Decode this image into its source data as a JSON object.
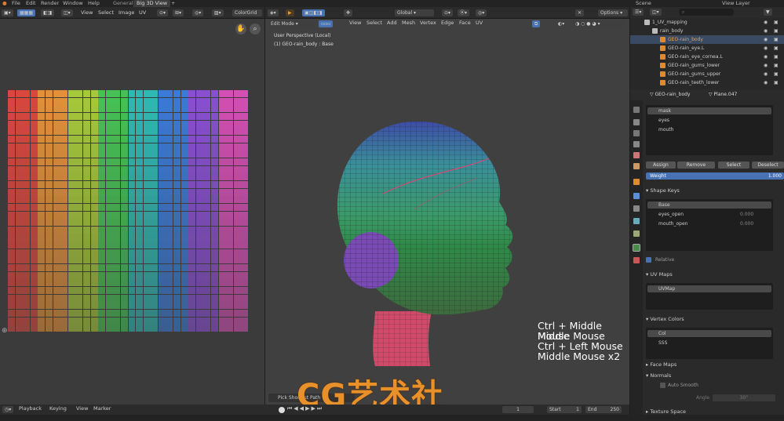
{
  "topbar": {
    "menus": [
      "File",
      "Edit",
      "Render",
      "Window",
      "Help"
    ],
    "workspace_tabs": [
      "General",
      "Big 3D View"
    ],
    "active_tab": "Big 3D View",
    "scene_label": "Scene",
    "view_layer_label": "View Layer"
  },
  "uv_editor": {
    "menus": [
      "View",
      "Select",
      "Image",
      "UV"
    ],
    "image_name": "ColorGrid",
    "grid_colors": [
      "#d9473f",
      "#e2913a",
      "#a5c93a",
      "#46c254",
      "#2fb9b3",
      "#3b7ad6",
      "#8a4fd1",
      "#d34fb3"
    ]
  },
  "viewport": {
    "mode": "Edit Mode",
    "menus": [
      "View",
      "Select",
      "Add",
      "Mesh",
      "Vertex",
      "Edge",
      "Face",
      "UV"
    ],
    "orientation": "Global",
    "options_label": "Options",
    "perspective_label": "User Perspective (Local)",
    "object_label": "(1) GEO-rain_body : Base",
    "pick_shortest_path": "Pick Shortest Path",
    "shortcut_hints": [
      "Ctrl + Middle Mouse",
      "Middle Mouse",
      "Ctrl + Left Mouse",
      "Middle Mouse x2"
    ],
    "watermark": "CG艺术社"
  },
  "outliner": {
    "rows": [
      {
        "label": "1_UV_mapping",
        "indent": 1
      },
      {
        "label": "rain_body",
        "indent": 2
      },
      {
        "label": "GEO-rain_body",
        "indent": 3,
        "selected": true
      },
      {
        "label": "GEO-rain_eye.L",
        "indent": 3
      },
      {
        "label": "GEO-rain_eye_cornea.L",
        "indent": 3
      },
      {
        "label": "GEO-rain_gums_lower",
        "indent": 3
      },
      {
        "label": "GEO-rain_gums_upper",
        "indent": 3
      },
      {
        "label": "GEO-rain_teeth_lower",
        "indent": 3
      }
    ]
  },
  "properties": {
    "object_name": "GEO-rain_body",
    "mesh_name": "Plane.047",
    "vertex_groups": [
      "mask",
      "eyes",
      "mouth"
    ],
    "vg_buttons": {
      "assign": "Assign",
      "remove": "Remove",
      "select": "Select",
      "deselect": "Deselect"
    },
    "weight_label": "Weight",
    "weight_value": "1.000",
    "shape_keys_title": "Shape Keys",
    "shape_keys": [
      {
        "name": "Base",
        "value": ""
      },
      {
        "name": "eyes_open",
        "value": "0.000"
      },
      {
        "name": "mouth_open",
        "value": "0.000"
      }
    ],
    "relative_label": "Relative",
    "uv_maps_title": "UV Maps",
    "uv_maps": [
      "UVMap"
    ],
    "vertex_colors_title": "Vertex Colors",
    "vertex_colors": [
      "Col",
      "SSS"
    ],
    "face_maps_title": "Face Maps",
    "normals_title": "Normals",
    "auto_smooth_label": "Auto Smooth",
    "angle_label": "Angle",
    "angle_value": "30°",
    "texture_space_title": "Texture Space"
  },
  "timeline": {
    "menus": [
      "Playback",
      "Keying",
      "View",
      "Marker"
    ],
    "current_frame": "1",
    "start_label": "Start",
    "start_value": "1",
    "end_label": "End",
    "end_value": "250"
  }
}
